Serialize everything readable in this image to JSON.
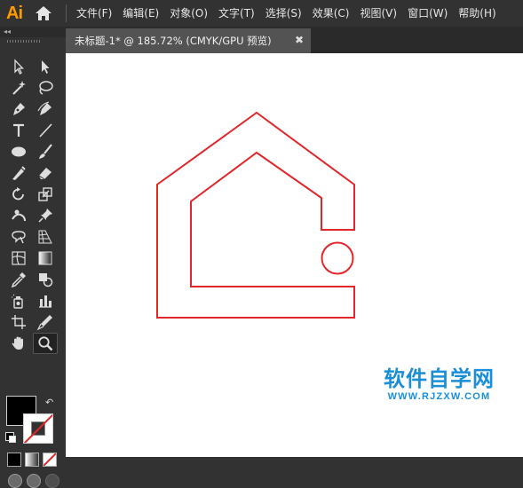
{
  "app": {
    "logo": "Ai",
    "menu": [
      "文件(F)",
      "编辑(E)",
      "对象(O)",
      "文字(T)",
      "选择(S)",
      "效果(C)",
      "视图(V)",
      "窗口(W)",
      "帮助(H)"
    ]
  },
  "document": {
    "tab_title": "未标题-1* @ 185.72% (CMYK/GPU 预览)",
    "close_glyph": "✖"
  },
  "toolbar": {
    "collapse_glyph": "◂◂",
    "tools": [
      "selection-tool",
      "direct-selection-tool",
      "magic-wand-tool",
      "lasso-tool",
      "pen-tool",
      "curvature-tool",
      "type-tool",
      "line-segment-tool",
      "ellipse-tool",
      "paintbrush-tool",
      "shaper-tool",
      "eraser-tool",
      "rotate-tool",
      "scale-tool",
      "puppet-warp-tool",
      "pin-tool",
      "free-transform-tool",
      "perspective-grid-tool",
      "mesh-tool",
      "gradient-tool",
      "eyedropper-tool",
      "live-paint-tool",
      "symbol-sprayer-tool",
      "column-graph-tool",
      "artboard-tool",
      "slice-tool",
      "hand-tool",
      "zoom-tool"
    ],
    "active_tool": "zoom-tool",
    "fill_color": "#000000",
    "stroke": "none",
    "swap_glyph": "↶"
  },
  "artwork": {
    "stroke_color": "#e2262a",
    "shape": "house-outline-with-circle"
  },
  "watermark": {
    "title": "软件自学网",
    "url": "WWW.RJZXW.COM",
    "color": "#1a8fd8"
  }
}
